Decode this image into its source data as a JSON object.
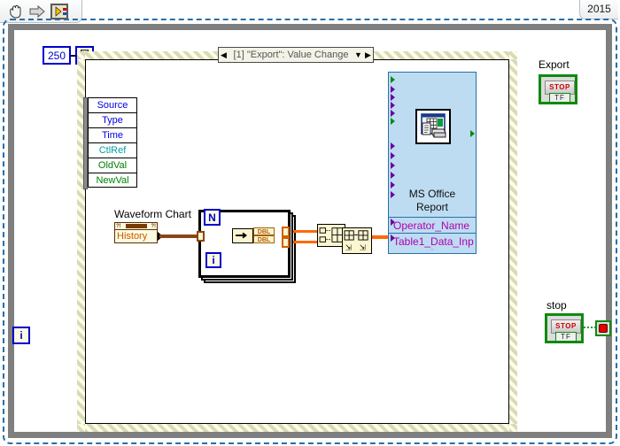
{
  "window": {
    "version_label": "2015",
    "toolbar_icons": [
      "hand-tool-icon",
      "arrow-right-icon",
      "labview-vi-icon"
    ]
  },
  "diagram": {
    "wait_constant": "250",
    "wait_node_icon": "hourglass-timer-icon",
    "while_loop_iteration_label": "i",
    "event_structure": {
      "case_label": "[1] \"Export\": Value Change",
      "prev_arrow": "◀",
      "next_arrow": "▶",
      "dropdown_arrow": "▼",
      "event_data_node": [
        {
          "label": "Source",
          "color": "blue"
        },
        {
          "label": "Type",
          "color": "blue"
        },
        {
          "label": "Time",
          "color": "blue"
        },
        {
          "label": "CtlRef",
          "color": "teal"
        },
        {
          "label": "OldVal",
          "color": "green"
        },
        {
          "label": "NewVal",
          "color": "green"
        }
      ]
    },
    "waveform_chart": {
      "label": "Waveform Chart",
      "property": "History"
    },
    "for_loop": {
      "count_terminal": "N",
      "iteration_terminal": "i",
      "index_array_icon": "index-array-icon",
      "output_types": [
        "DBL",
        "DBL"
      ]
    },
    "build_array_icon": "build-array-icon",
    "transpose_icon": "transpose-2d-array-icon",
    "express_vi": {
      "title_line1": "MS Office",
      "title_line2": "Report",
      "icon": "report-generation-icon",
      "inputs": [
        "Operator_Name",
        "Table1_Data_Inp"
      ],
      "expand_chevron": "⌄"
    },
    "controls": [
      {
        "name": "Export",
        "label": "Export",
        "glyph": "STOP",
        "tf": "TF"
      },
      {
        "name": "stop",
        "label": "stop",
        "glyph": "STOP",
        "tf": "TF"
      }
    ],
    "loop_condition_icon": "stop-conditional-terminal-icon"
  },
  "colors": {
    "wire_orange": "#ff6a00",
    "wire_brown": "#8b4513",
    "wire_green": "#17a02f",
    "wire_purple": "#9a00c8",
    "terminal_blue": "#0000cc",
    "control_green": "#0f8a0f",
    "express_fill": "#bddcf2",
    "loop_gray": "#7f7f7f"
  }
}
